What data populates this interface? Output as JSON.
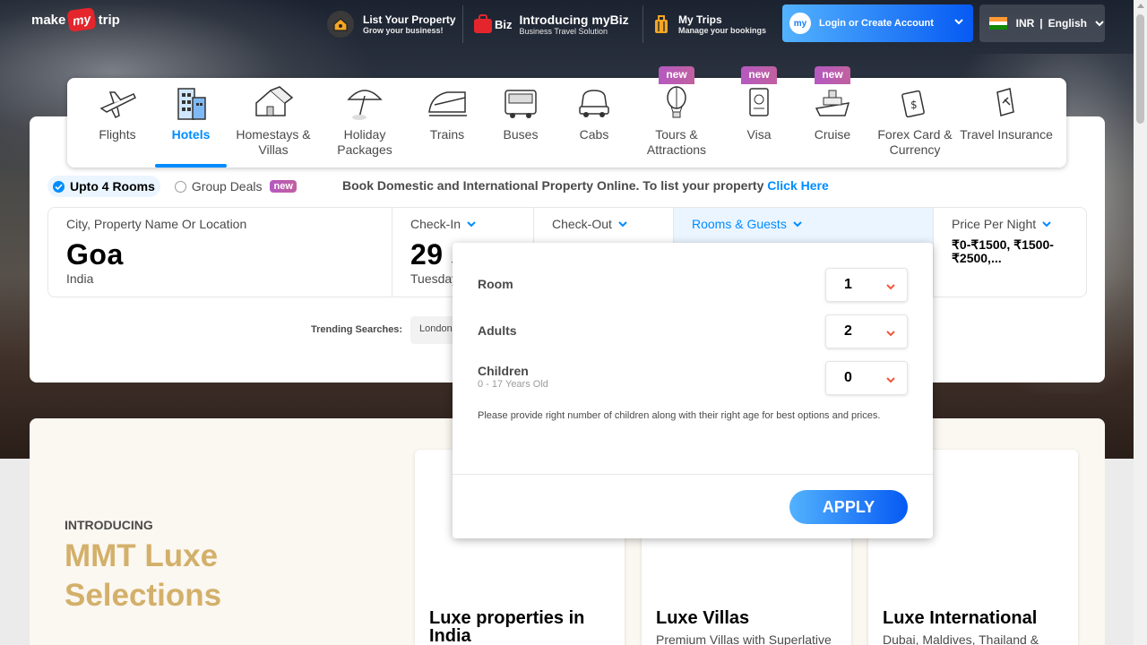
{
  "header": {
    "logo": {
      "pre": "make",
      "my": "my",
      "post": "trip"
    },
    "list_property": {
      "title": "List Your Property",
      "subtitle": "Grow your business!"
    },
    "mybiz": {
      "badge": "Biz",
      "title": "Introducing myBiz",
      "subtitle": "Business Travel Solution"
    },
    "my_trips": {
      "title": "My Trips",
      "subtitle": "Manage your bookings"
    },
    "login": {
      "icon_text": "my",
      "label": "Login or Create Account"
    },
    "locale": {
      "currency": "INR",
      "separator": "|",
      "language": "English"
    }
  },
  "nav": [
    {
      "label": "Flights",
      "icon": "airplane-icon",
      "badge": ""
    },
    {
      "label": "Hotels",
      "icon": "hotel-building-icon",
      "badge": "",
      "active": true
    },
    {
      "label": "Homestays & Villas",
      "icon": "house-icon",
      "badge": ""
    },
    {
      "label": "Holiday Packages",
      "icon": "beach-umbrella-icon",
      "badge": ""
    },
    {
      "label": "Trains",
      "icon": "train-icon",
      "badge": ""
    },
    {
      "label": "Buses",
      "icon": "bus-icon",
      "badge": ""
    },
    {
      "label": "Cabs",
      "icon": "car-icon",
      "badge": ""
    },
    {
      "label": "Tours & Attractions",
      "icon": "hot-air-balloon-icon",
      "badge": "new"
    },
    {
      "label": "Visa",
      "icon": "passport-icon",
      "badge": "new"
    },
    {
      "label": "Cruise",
      "icon": "ship-icon",
      "badge": "new"
    },
    {
      "label": "Forex Card & Currency",
      "icon": "currency-card-icon",
      "badge": ""
    },
    {
      "label": "Travel Insurance",
      "icon": "insurance-shield-icon",
      "badge": ""
    }
  ],
  "room_type": {
    "option1": "Upto 4 Rooms",
    "option2": "Group Deals",
    "new_badge": "new",
    "book_text": "Book Domestic and International Property Online. To list your property",
    "click_here": "Click Here"
  },
  "search": {
    "city": {
      "label": "City, Property Name Or Location",
      "value": "Goa",
      "sub": "India"
    },
    "checkin": {
      "label": "Check-In",
      "day": "29",
      "month_partial": "J",
      "weekday": "Tuesday"
    },
    "checkout": {
      "label": "Check-Out"
    },
    "rooms": {
      "label": "Rooms & Guests"
    },
    "price": {
      "label": "Price Per Night",
      "value": "₹0-₹1500, ₹1500-₹2500,..."
    }
  },
  "trending": {
    "label": "Trending Searches:",
    "chip": "London"
  },
  "rooms_popup": {
    "room_label": "Room",
    "room_value": "1",
    "adults_label": "Adults",
    "adults_value": "2",
    "children_label": "Children",
    "children_sub": "0 - 17 Years Old",
    "children_value": "0",
    "note": "Please provide right number of children along with their right age for best options and prices.",
    "apply": "APPLY"
  },
  "luxe": {
    "intro": "INTRODUCING",
    "title": "MMT Luxe Selections",
    "cards": [
      {
        "title": "Luxe properties in India",
        "sub": ""
      },
      {
        "title": "Luxe Villas",
        "sub": "Premium Villas with Superlative"
      },
      {
        "title": "Luxe International",
        "sub": "Dubai, Maldives, Thailand &"
      }
    ]
  },
  "colors": {
    "accent": "#008cff",
    "brand_red": "#e4262c",
    "luxe_gold": "#d3b06a",
    "new_badge": "#b559c1"
  }
}
